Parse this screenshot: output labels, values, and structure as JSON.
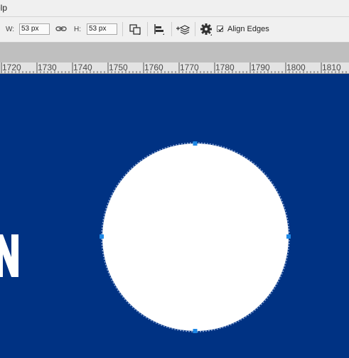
{
  "menu": {
    "help_partial": "elp"
  },
  "options": {
    "width_label": "W:",
    "width_value": "53 px",
    "height_label": "H:",
    "height_value": "53 px",
    "align_edges_label": "Align Edges",
    "align_edges_checked": true
  },
  "ruler": {
    "ticks": [
      "1720",
      "1730",
      "1740",
      "1750",
      "1760",
      "1770",
      "1780",
      "1790",
      "1800",
      "1810"
    ]
  },
  "canvas": {
    "background_color": "#003283",
    "shape_color": "#ffffff",
    "anchor_color": "#1e88e5",
    "partial_glyph": "N"
  }
}
